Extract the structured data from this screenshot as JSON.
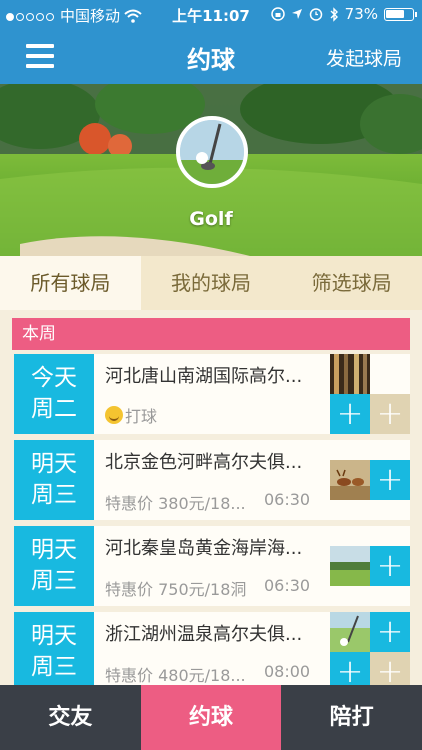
{
  "status_bar": {
    "carrier": "中国移动",
    "time": "上午11:07",
    "battery": "73%",
    "battery_level": 0.73
  },
  "nav": {
    "title": "约球",
    "action": "发起球局"
  },
  "hero": {
    "label": "Golf"
  },
  "tabs": [
    {
      "label": "所有球局"
    },
    {
      "label": "我的球局"
    },
    {
      "label": "筛选球局"
    }
  ],
  "section": {
    "title": "本周"
  },
  "games": [
    {
      "day": "今天",
      "weekday": "周二",
      "title": "河北唐山南湖国际高尔...",
      "tag": "打球",
      "price": "",
      "time": ""
    },
    {
      "day": "明天",
      "weekday": "周三",
      "title": "北京金色河畔高尔夫俱...",
      "tag": "",
      "price": "特惠价 380元/18...",
      "time": "06:30"
    },
    {
      "day": "明天",
      "weekday": "周三",
      "title": "河北秦皇岛黄金海岸海...",
      "tag": "",
      "price": "特惠价 750元/18洞",
      "time": "06:30"
    },
    {
      "day": "明天",
      "weekday": "周三",
      "title": "浙江湖州温泉高尔夫俱...",
      "tag": "",
      "price": "特惠价 480元/18...",
      "time": "08:00"
    }
  ],
  "bottom_tabs": [
    {
      "label": "交友"
    },
    {
      "label": "约球"
    },
    {
      "label": "陪打"
    }
  ],
  "icons": {
    "menu": "menu-icon",
    "plus": "plus-icon",
    "smile": "smile-icon",
    "wifi": "wifi-icon",
    "location": "location-arrow-icon",
    "alarm": "alarm-icon",
    "bluetooth": "bluetooth-icon",
    "lock": "rotation-lock-icon"
  },
  "colors": {
    "nav_blue": "#2f93cf",
    "date_cyan": "#18b9e0",
    "accent_pink": "#ed5d83",
    "bottom_dark": "#3a3f47",
    "tab_tan": "#f3e8cc"
  }
}
